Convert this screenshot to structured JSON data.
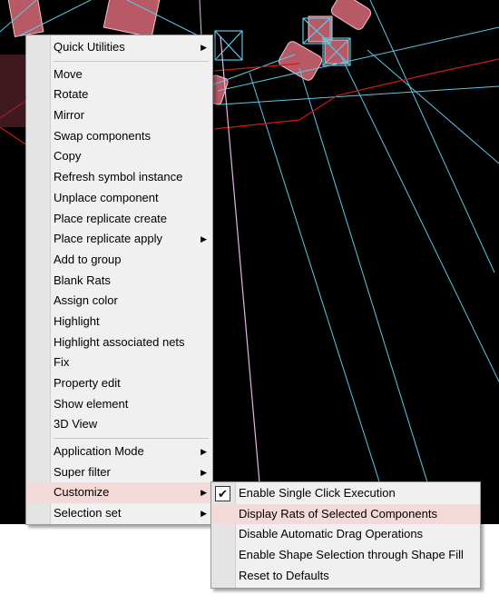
{
  "context_menu": {
    "items": [
      {
        "label": "Quick Utilities",
        "submenu": true
      },
      {
        "label": "Move"
      },
      {
        "label": "Rotate"
      },
      {
        "label": "Mirror"
      },
      {
        "label": "Swap components"
      },
      {
        "label": "Copy"
      },
      {
        "label": "Refresh symbol instance"
      },
      {
        "label": "Unplace component"
      },
      {
        "label": "Place replicate create"
      },
      {
        "label": "Place replicate apply",
        "submenu": true
      },
      {
        "label": "Add to group"
      },
      {
        "label": "Blank Rats"
      },
      {
        "label": "Assign color"
      },
      {
        "label": "Highlight"
      },
      {
        "label": "Highlight associated nets"
      },
      {
        "label": "Fix"
      },
      {
        "label": "Property edit"
      },
      {
        "label": "Show element"
      },
      {
        "label": "3D View"
      },
      {
        "label": "Application Mode",
        "submenu": true
      },
      {
        "label": "Super filter",
        "submenu": true
      },
      {
        "label": "Customize",
        "submenu": true,
        "highlighted": true
      },
      {
        "label": "Selection set",
        "submenu": true
      }
    ]
  },
  "customize_submenu": {
    "items": [
      {
        "label": "Enable Single Click Execution",
        "checked": true
      },
      {
        "label": "Display Rats of Selected Components",
        "highlighted": true
      },
      {
        "label": "Disable Automatic Drag Operations"
      },
      {
        "label": "Enable Shape Selection through Shape Fill"
      },
      {
        "label": "Reset to Defaults"
      }
    ]
  },
  "icons": {
    "submenu_arrow": "arrow-right-icon",
    "check": "checkmark-icon"
  },
  "colors": {
    "canvas_background": "#000000",
    "component_fill": "#b85a66",
    "net_cyan": "#5bc8e6",
    "net_red": "#d01818",
    "net_pink": "#e7b4e6",
    "menu_background": "#f0f0f0",
    "menu_highlight": "#f4d9d9"
  }
}
